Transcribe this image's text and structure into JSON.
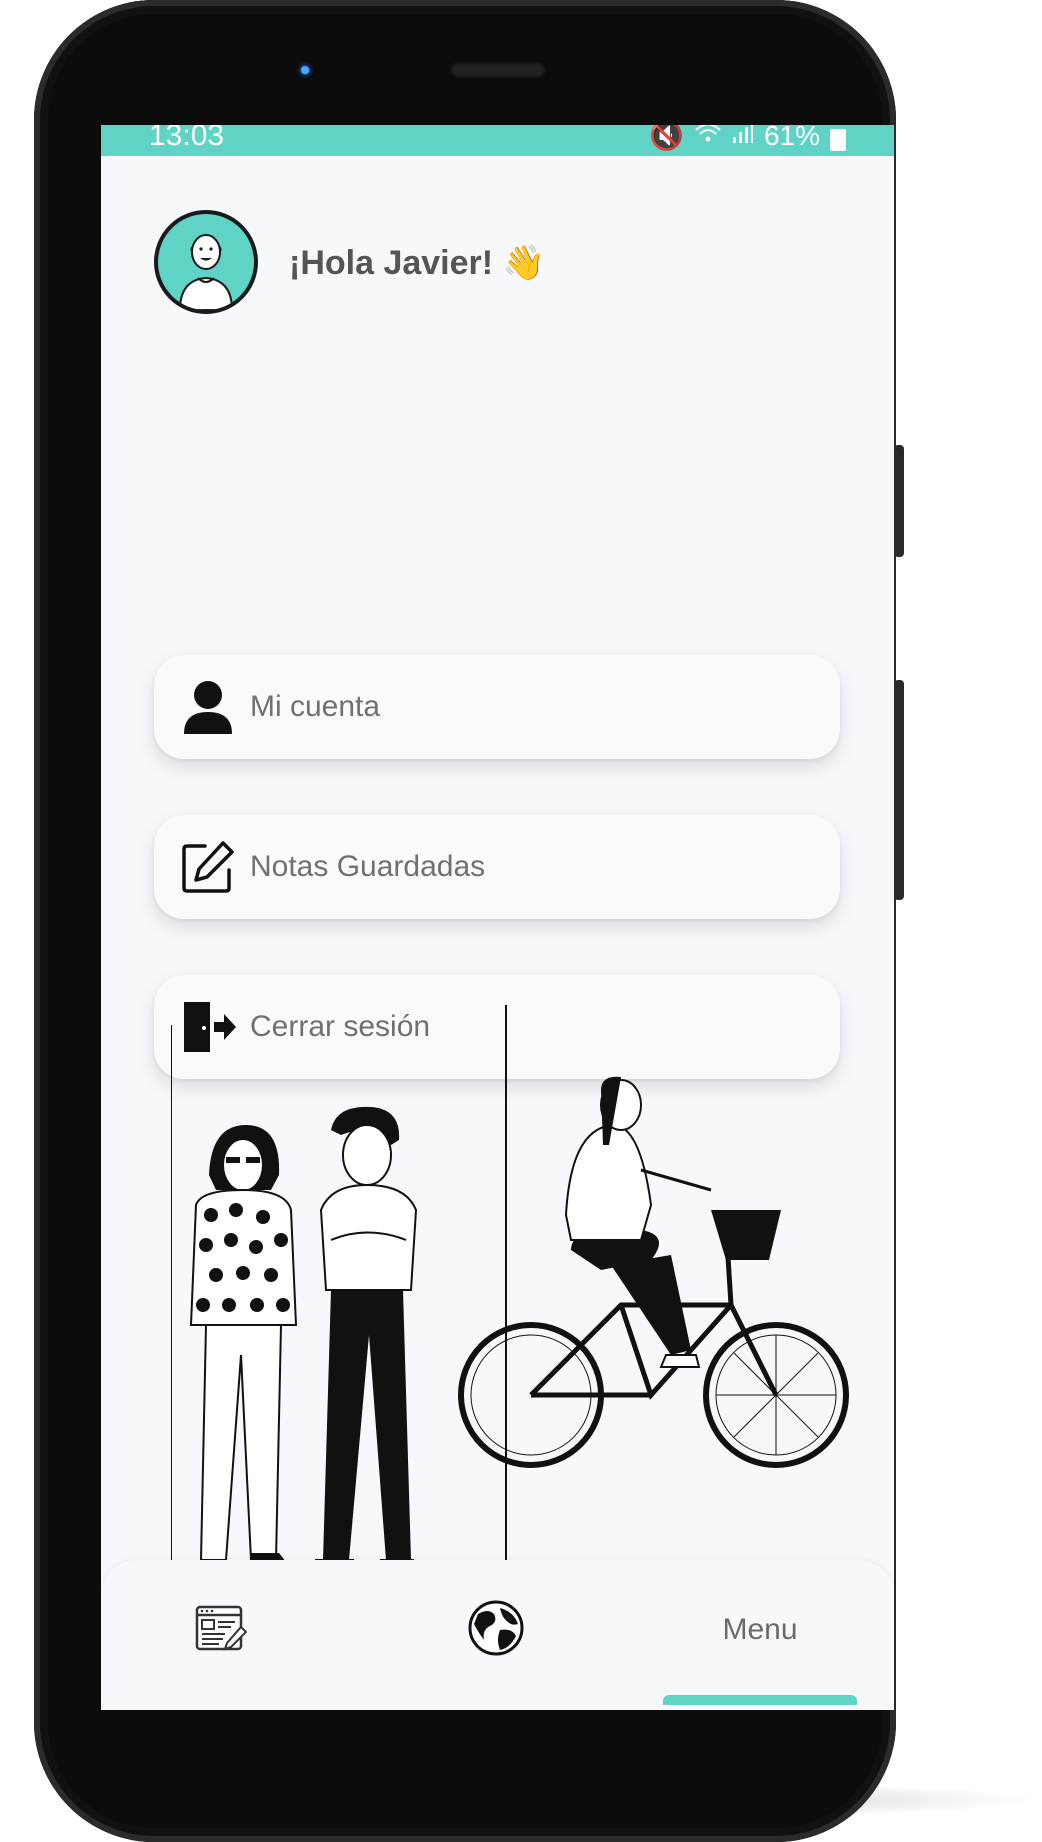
{
  "status_bar": {
    "time": "13:03",
    "battery": "61%",
    "icons": [
      "mute-icon",
      "wifi-icon",
      "signal-icon",
      "battery-icon"
    ]
  },
  "header": {
    "greeting": "¡Hola Javier!",
    "emoji": "👋",
    "avatar_icon": "user-avatar"
  },
  "menu": {
    "items": [
      {
        "label": "Mi cuenta",
        "icon": "user-icon"
      },
      {
        "label": "Notas Guardadas",
        "icon": "edit-note-icon"
      },
      {
        "label": "Cerrar sesión",
        "icon": "logout-door-icon"
      }
    ]
  },
  "bottom_nav": {
    "items": [
      {
        "icon": "news-edit-icon",
        "label": ""
      },
      {
        "icon": "globe-icon",
        "label": ""
      },
      {
        "icon": "",
        "label": "Menu"
      }
    ],
    "active_index": 2
  },
  "colors": {
    "accent": "#5fd3c6",
    "background": "#f7f8fc",
    "card": "#fafafa",
    "text_muted": "#707070",
    "greeting_text": "#555555"
  }
}
